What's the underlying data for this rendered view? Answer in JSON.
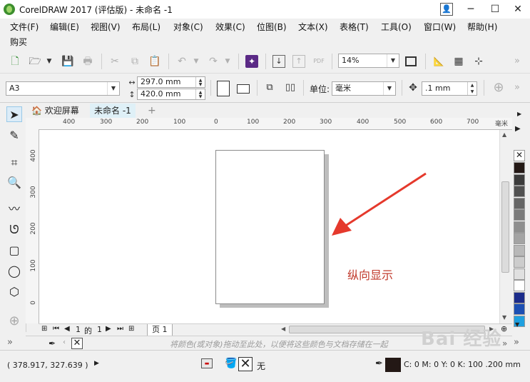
{
  "window": {
    "title": "CorelDRAW 2017 (评估版) - 未命名 -1",
    "controls": {
      "minimize": "─",
      "maximize": "☐",
      "close": "✕"
    }
  },
  "menu": {
    "items": [
      "文件(F)",
      "编辑(E)",
      "视图(V)",
      "布局(L)",
      "对象(C)",
      "效果(C)",
      "位图(B)",
      "文本(X)",
      "表格(T)",
      "工具(O)",
      "窗口(W)",
      "帮助(H)"
    ],
    "second_row": [
      "购买"
    ]
  },
  "toolbar": {
    "zoom_value": "14%"
  },
  "properties": {
    "page_size": "A3",
    "width": "297.0 mm",
    "height": "420.0 mm",
    "units_label": "单位:",
    "units_value": "毫米",
    "nudge": ".1 mm"
  },
  "tabs": [
    {
      "label": "欢迎屏幕",
      "active": false
    },
    {
      "label": "未命名 -1",
      "active": true
    }
  ],
  "rulers": {
    "horizontal_labels": [
      "400",
      "300",
      "200",
      "100",
      "0",
      "100",
      "200",
      "300",
      "400",
      "500",
      "600",
      "700"
    ],
    "horizontal_unit": "毫米",
    "vertical_labels": [
      "400",
      "300",
      "200",
      "100",
      "0"
    ]
  },
  "page_navigation": {
    "current": "1",
    "of_label": "的",
    "total": "1",
    "page_tab": "页 1"
  },
  "doc_palette": {
    "hint": "将颜色(或对象)拖动至此处，以便将这些颜色与文档存储在一起"
  },
  "annotation": {
    "text": "纵向显示",
    "color": "#c0392b"
  },
  "status": {
    "coordinates": "( 378.917, 327.639 )",
    "fill_label": "无",
    "outline": "C: 0 M: 0 Y: 0 K: 100 .200 mm"
  },
  "palette": {
    "colors": [
      "#231815",
      "#3b3b3b",
      "#505050",
      "#666666",
      "#7a7a7a",
      "#8e8e8e",
      "#a3a3a3",
      "#b8b8b8",
      "#cccccc",
      "#e0e0e0",
      "#ffffff",
      "#1b2b8a",
      "#1c4fb3",
      "#1ea0e0"
    ]
  },
  "watermark": {
    "text": "Bai 经验"
  },
  "colors": {
    "tab_accent": "#3aa9c7",
    "outline_swatch": "#231815"
  }
}
